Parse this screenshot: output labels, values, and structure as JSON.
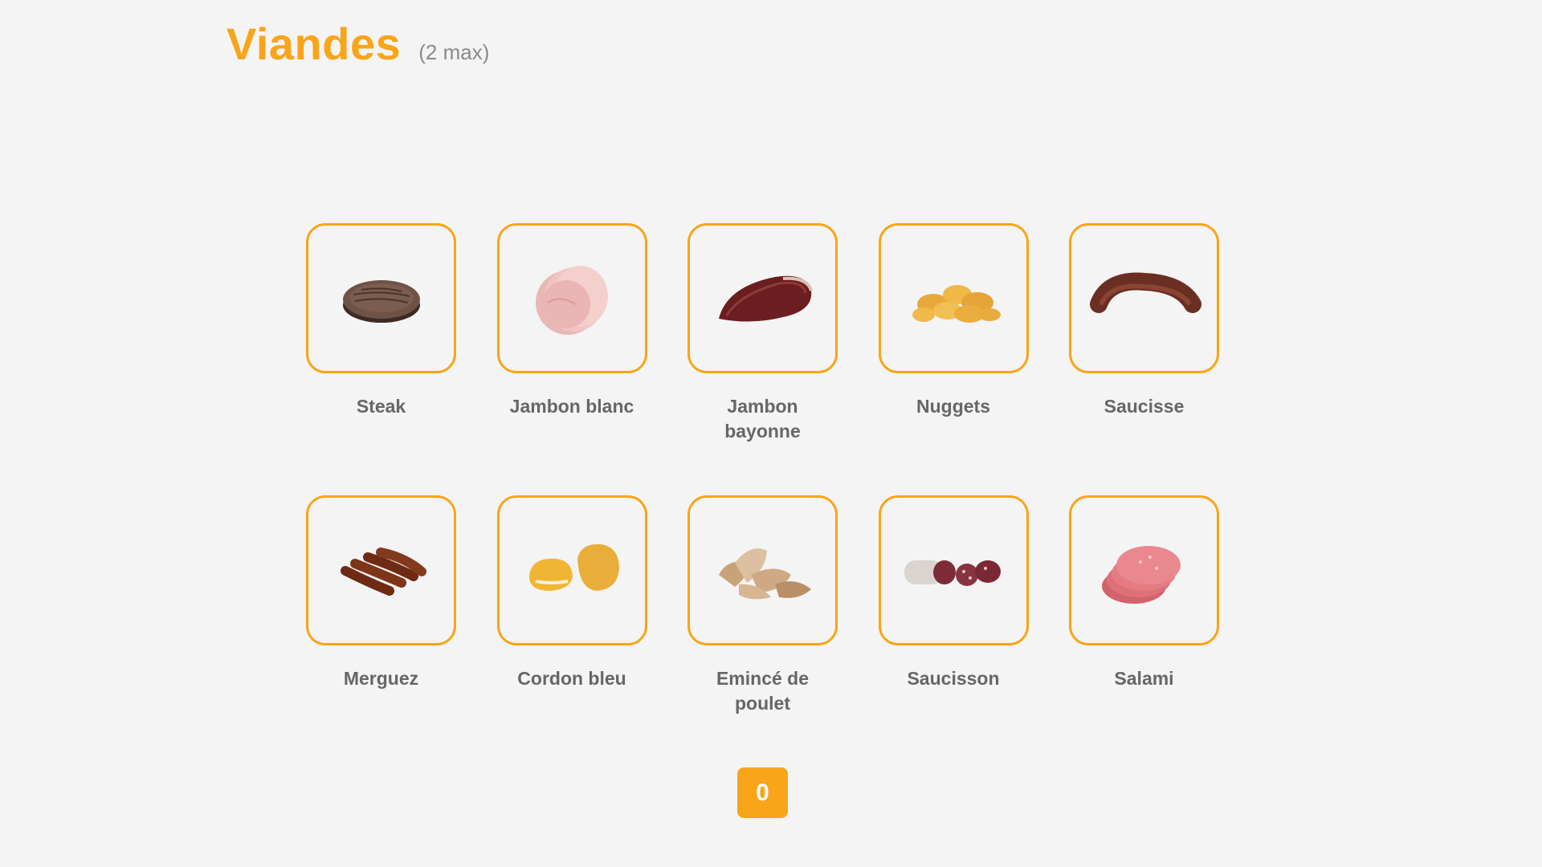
{
  "header": {
    "title": "Viandes",
    "subtitle": "(2 max)"
  },
  "items": [
    {
      "label": "Steak",
      "icon": "steak-icon"
    },
    {
      "label": "Jambon blanc",
      "icon": "ham-icon"
    },
    {
      "label": "Jambon bayonne",
      "icon": "cured-ham-icon"
    },
    {
      "label": "Nuggets",
      "icon": "nuggets-icon"
    },
    {
      "label": "Saucisse",
      "icon": "sausage-icon"
    },
    {
      "label": "Merguez",
      "icon": "merguez-icon"
    },
    {
      "label": "Cordon bleu",
      "icon": "cordon-bleu-icon"
    },
    {
      "label": "Emincé de poulet",
      "icon": "sliced-chicken-icon"
    },
    {
      "label": "Saucisson",
      "icon": "saucisson-icon"
    },
    {
      "label": "Salami",
      "icon": "salami-icon"
    }
  ],
  "counter": {
    "value": "0"
  },
  "colors": {
    "accent": "#f9a51a",
    "label": "#666666",
    "background": "#f4f4f4"
  }
}
